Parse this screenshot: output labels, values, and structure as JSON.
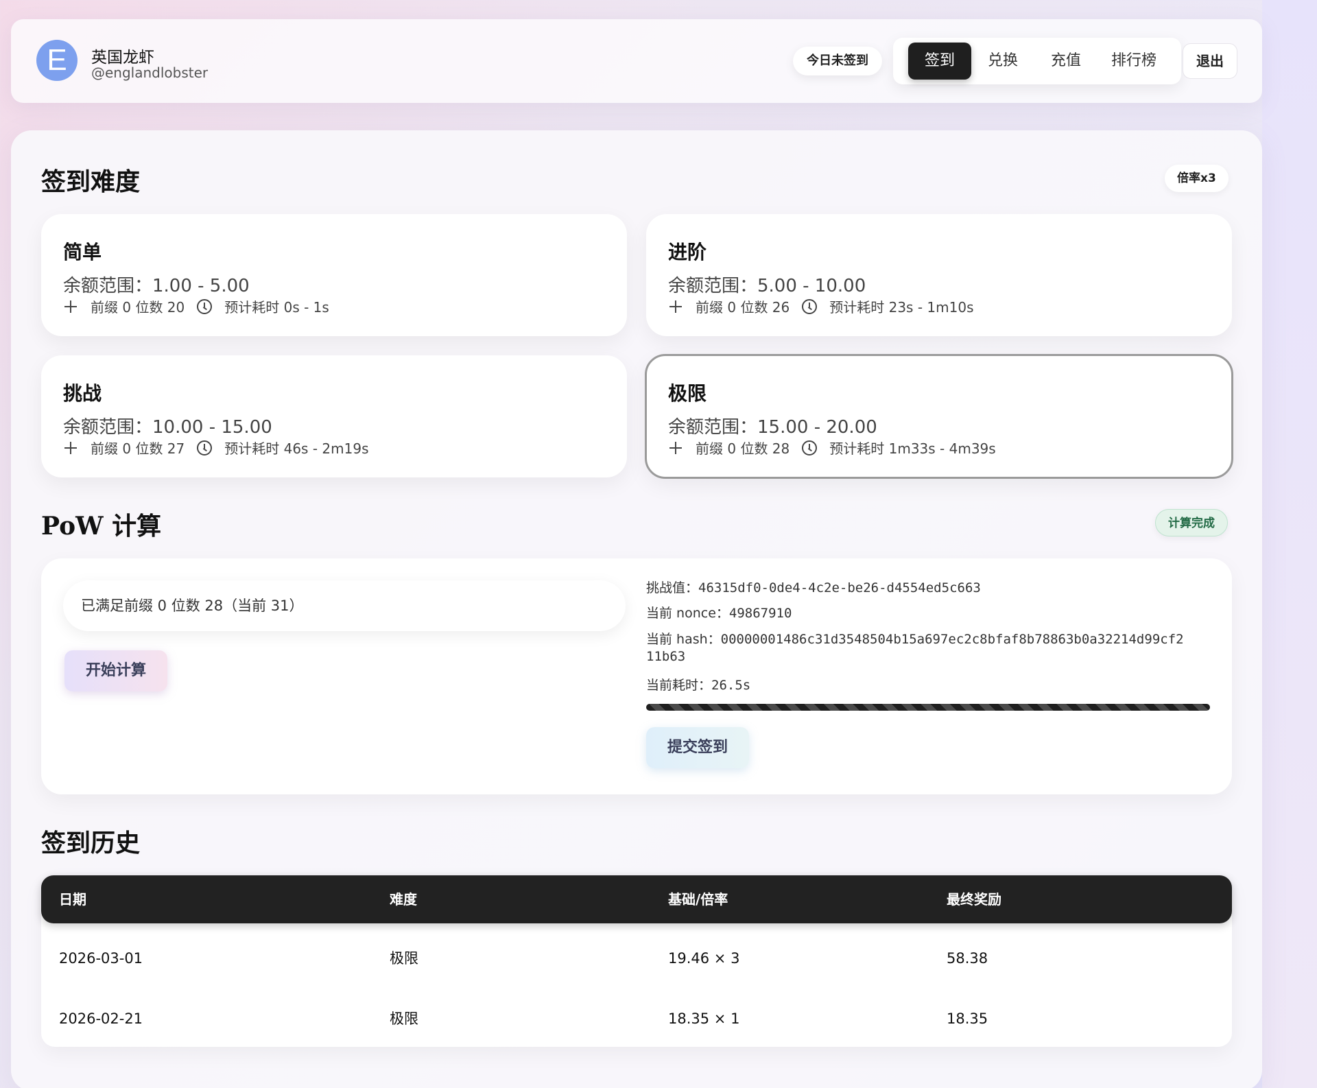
{
  "user": {
    "avatar_letter": "E",
    "name": "英国龙虾",
    "handle": "@englandlobster",
    "avatar_color": "#7da0ee"
  },
  "header": {
    "status": "今日未签到",
    "nav": [
      "签到",
      "兑换",
      "充值",
      "排行榜"
    ],
    "active_nav": "签到",
    "logout": "退出"
  },
  "difficulty": {
    "title": "签到难度",
    "multiplier_badge": "倍率x3",
    "cards": [
      {
        "name": "简单",
        "range": "余额范围：1.00 - 5.00",
        "prefix": "前缀 0 位数 20",
        "time": "预计耗时 0s - 1s",
        "selected": false
      },
      {
        "name": "进阶",
        "range": "余额范围：5.00 - 10.00",
        "prefix": "前缀 0 位数 26",
        "time": "预计耗时 23s - 1m10s",
        "selected": false
      },
      {
        "name": "挑战",
        "range": "余额范围：10.00 - 15.00",
        "prefix": "前缀 0 位数 27",
        "time": "预计耗时 46s - 2m19s",
        "selected": false
      },
      {
        "name": "极限",
        "range": "余额范围：15.00 - 20.00",
        "prefix": "前缀 0 位数 28",
        "time": "预计耗时 1m33s - 4m39s",
        "selected": true
      }
    ]
  },
  "pow": {
    "title": "PoW 计算",
    "status_badge": "计算完成",
    "status_text": "已满足前缀 0 位数 28（当前 31）",
    "start_label": "开始计算",
    "challenge_label": "挑战值：",
    "challenge_value": "46315df0-0de4-4c2e-be26-d4554ed5c663",
    "nonce_label": "当前 nonce：",
    "nonce_value": "49867910",
    "hash_label": "当前 hash：",
    "hash_value_line1": "00000001486c31d3548504b15a697ec2c8bfaf8b78863b0a32214d99cf2",
    "hash_value_line2": "11b63",
    "elapsed_label": "当前耗时：",
    "elapsed_value": "26.5s",
    "progress": 1.0,
    "submit_label": "提交签到"
  },
  "history": {
    "title": "签到历史",
    "columns": [
      "日期",
      "难度",
      "基础/倍率",
      "最终奖励"
    ],
    "rows": [
      [
        "2026-03-01",
        "极限",
        "19.46 × 3",
        "58.38"
      ],
      [
        "2026-02-21",
        "极限",
        "18.35 × 1",
        "18.35"
      ]
    ]
  }
}
